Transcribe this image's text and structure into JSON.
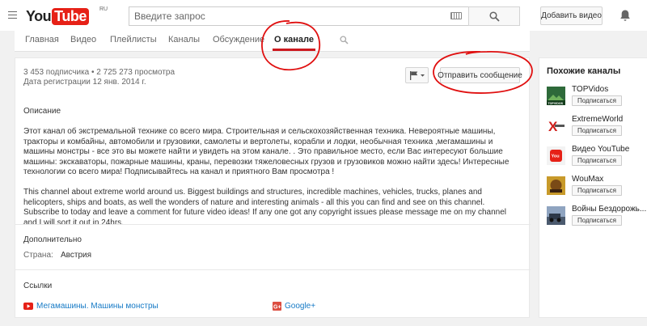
{
  "masthead": {
    "logo_you": "You",
    "logo_tube": "Tube",
    "logo_region": "RU",
    "search_placeholder": "Введите запрос",
    "add_video_label": "Добавить видео"
  },
  "tabs": [
    {
      "label": "Главная",
      "active": false
    },
    {
      "label": "Видео",
      "active": false
    },
    {
      "label": "Плейлисты",
      "active": false
    },
    {
      "label": "Каналы",
      "active": false
    },
    {
      "label": "Обсуждение",
      "active": false
    },
    {
      "label": "О канале",
      "active": true
    }
  ],
  "about": {
    "stats_line": "3 453 подписчика • 2 725 273 просмотра",
    "joined": "Дата регистрации 12 янв. 2014 г.",
    "send_message_label": "Отправить сообщение",
    "description_title": "Описание",
    "description_ru": "Этот канал об экстремальной технике со всего мира. Строительная и сельскохозяйственная техника. Невероятные машины, тракторы и комбайны, автомобили и грузовики, самолеты и вертолеты, корабли и лодки, необычная техника ,мегамашины и машины монстры - все это вы можете найти и увидеть на этом канале. . Это правильное место, если Вас интересуют большие машины: экскаваторы, пожарные машины, краны, перевозки тяжеловесных грузов и грузовиков можно найти здесь! Интересные технологии со всего мира! Подписывайтесь на канал и приятного Вам просмотра !",
    "description_en": "This channel about extreme world around us. Biggest buildings and structures, incredible machines, vehicles, trucks, planes and helicopters, ships and boats, as well the wonders of nature and interesting animals - all this you can find and see on this channel. Subscribe to today and leave a comment for future video ideas! If any one got any copyright issues please message me on my channel and I will sort it out in 24hrs.",
    "additional_title": "Дополнительно",
    "country_label": "Страна:",
    "country_value": "Австрия",
    "links_title": "Ссылки",
    "links": [
      {
        "label": "Мегамашины. Машины монстры",
        "icon": "youtube-icon"
      },
      {
        "label": "Google+",
        "icon": "google-plus-icon"
      }
    ]
  },
  "sidebar": {
    "title": "Похожие каналы",
    "subscribe_label": "Подписаться",
    "channels": [
      {
        "name": "TOPVidos",
        "thumb_text": "TOPVIDOS"
      },
      {
        "name": "ExtremeWorld",
        "thumb_text": "X"
      },
      {
        "name": "Видео YouTube",
        "thumb_text": "You"
      },
      {
        "name": "WouMax",
        "thumb_text": ""
      },
      {
        "name": "Войны Бездорожь...",
        "thumb_text": ""
      }
    ]
  },
  "colors": {
    "youtube_red": "#e62117",
    "active_tab_underline": "#cc181e",
    "link_blue": "#167ac6",
    "annotation_red": "#e01010",
    "page_bg": "#f1f1f1"
  }
}
